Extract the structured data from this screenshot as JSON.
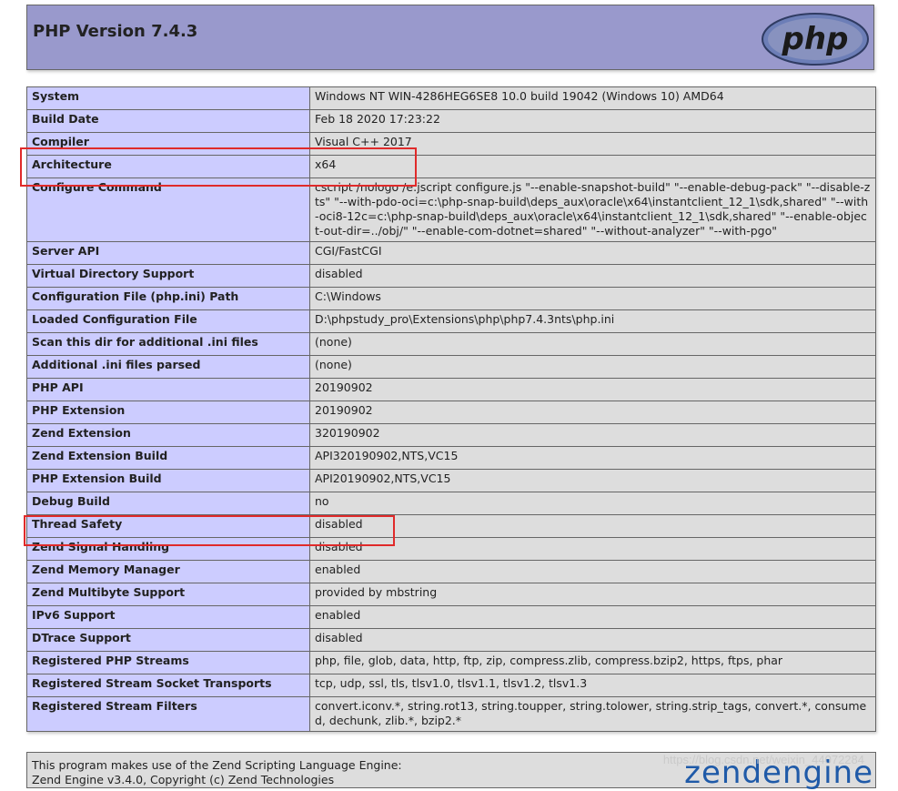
{
  "header": {
    "title": "PHP Version 7.4.3",
    "logo_text": "php"
  },
  "info_rows": [
    {
      "key": "System",
      "value": "Windows NT WIN-4286HEG6SE8 10.0 build 19042 (Windows 10) AMD64"
    },
    {
      "key": "Build Date",
      "value": "Feb 18 2020 17:23:22"
    },
    {
      "key": "Compiler",
      "value": "Visual C++ 2017"
    },
    {
      "key": "Architecture",
      "value": "x64"
    },
    {
      "key": "Configure Command",
      "value": "cscript /nologo /e:jscript configure.js \"--enable-snapshot-build\" \"--enable-debug-pack\" \"--disable-zts\" \"--with-pdo-oci=c:\\php-snap-build\\deps_aux\\oracle\\x64\\instantclient_12_1\\sdk,shared\" \"--with-oci8-12c=c:\\php-snap-build\\deps_aux\\oracle\\x64\\instantclient_12_1\\sdk,shared\" \"--enable-object-out-dir=../obj/\" \"--enable-com-dotnet=shared\" \"--without-analyzer\" \"--with-pgo\""
    },
    {
      "key": "Server API",
      "value": "CGI/FastCGI"
    },
    {
      "key": "Virtual Directory Support",
      "value": "disabled"
    },
    {
      "key": "Configuration File (php.ini) Path",
      "value": "C:\\Windows"
    },
    {
      "key": "Loaded Configuration File",
      "value": "D:\\phpstudy_pro\\Extensions\\php\\php7.4.3nts\\php.ini"
    },
    {
      "key": "Scan this dir for additional .ini files",
      "value": "(none)"
    },
    {
      "key": "Additional .ini files parsed",
      "value": "(none)"
    },
    {
      "key": "PHP API",
      "value": "20190902"
    },
    {
      "key": "PHP Extension",
      "value": "20190902"
    },
    {
      "key": "Zend Extension",
      "value": "320190902"
    },
    {
      "key": "Zend Extension Build",
      "value": "API320190902,NTS,VC15"
    },
    {
      "key": "PHP Extension Build",
      "value": "API20190902,NTS,VC15"
    },
    {
      "key": "Debug Build",
      "value": "no"
    },
    {
      "key": "Thread Safety",
      "value": "disabled"
    },
    {
      "key": "Zend Signal Handling",
      "value": "disabled"
    },
    {
      "key": "Zend Memory Manager",
      "value": "enabled"
    },
    {
      "key": "Zend Multibyte Support",
      "value": "provided by mbstring"
    },
    {
      "key": "IPv6 Support",
      "value": "enabled"
    },
    {
      "key": "DTrace Support",
      "value": "disabled"
    },
    {
      "key": "Registered PHP Streams",
      "value": "php, file, glob, data, http, ftp, zip, compress.zlib, compress.bzip2, https, ftps, phar"
    },
    {
      "key": "Registered Stream Socket Transports",
      "value": "tcp, udp, ssl, tls, tlsv1.0, tlsv1.1, tlsv1.2, tlsv1.3"
    },
    {
      "key": "Registered Stream Filters",
      "value": "convert.iconv.*, string.rot13, string.toupper, string.tolower, string.strip_tags, convert.*, consumed, dechunk, zlib.*, bzip2.*"
    }
  ],
  "footer": {
    "line1": "This program makes use of the Zend Scripting Language Engine:",
    "line2": "Zend Engine v3.4.0, Copyright (c) Zend Technologies",
    "logo_text": "zendengine"
  },
  "watermark": "https://blog.csdn.net/weixin_44072284",
  "colors": {
    "header_bg": "#9999cc",
    "key_bg": "#ccccff",
    "value_bg": "#dddddd",
    "annotation": "#e02a2a"
  }
}
